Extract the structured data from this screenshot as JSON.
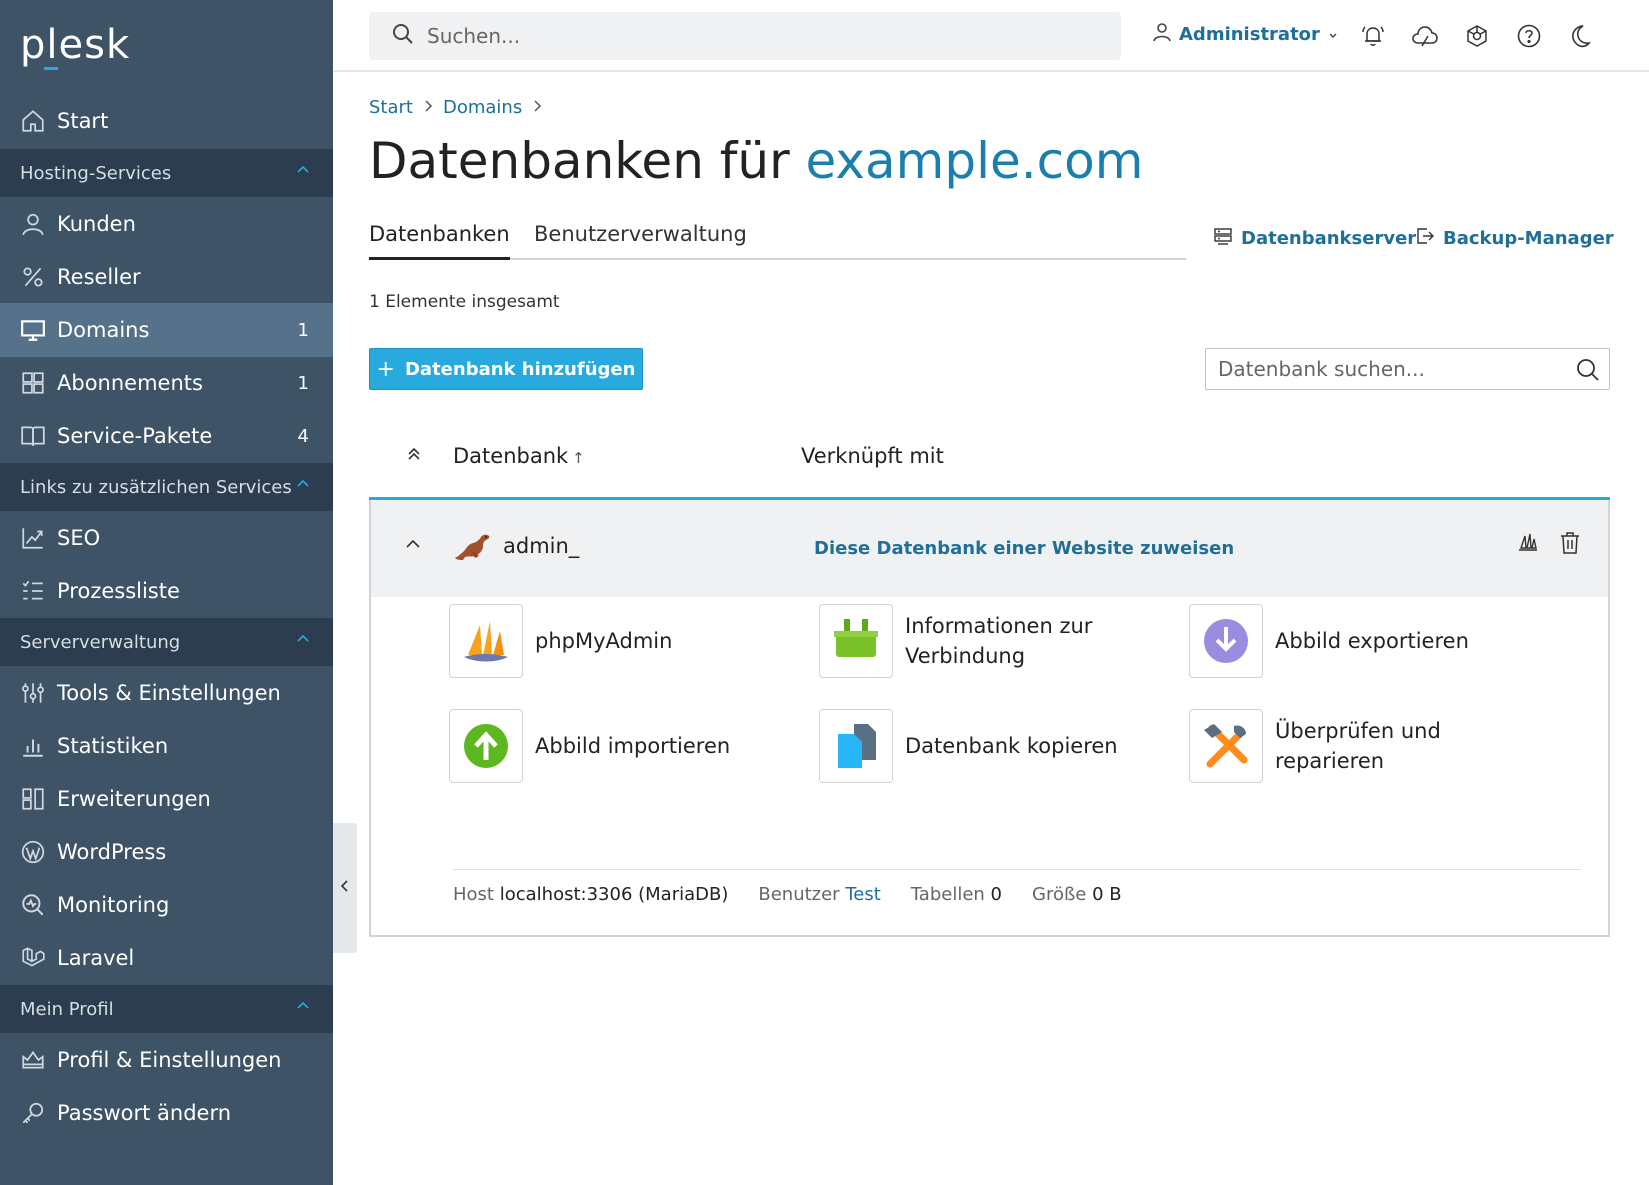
{
  "app": {
    "logo": "plesk"
  },
  "sidebar": {
    "items": [
      {
        "label": "Start",
        "icon": "home-icon"
      },
      {
        "section": "Hosting-Services"
      },
      {
        "label": "Kunden",
        "icon": "user-icon"
      },
      {
        "label": "Reseller",
        "icon": "percent-icon"
      },
      {
        "label": "Domains",
        "icon": "monitor-icon",
        "count": "1",
        "active": true
      },
      {
        "label": "Abonnements",
        "icon": "grid-icon",
        "count": "1"
      },
      {
        "label": "Service-Pakete",
        "icon": "book-icon",
        "count": "4"
      },
      {
        "section": "Links zu zusätzlichen Services"
      },
      {
        "label": "SEO",
        "icon": "chart-icon"
      },
      {
        "label": "Prozessliste",
        "icon": "list-icon"
      },
      {
        "section": "Serververwaltung"
      },
      {
        "label": "Tools & Einstellungen",
        "icon": "sliders-icon"
      },
      {
        "label": "Statistiken",
        "icon": "bar-chart-icon"
      },
      {
        "label": "Erweiterungen",
        "icon": "extensions-icon"
      },
      {
        "label": "WordPress",
        "icon": "wordpress-icon"
      },
      {
        "label": "Monitoring",
        "icon": "monitoring-icon"
      },
      {
        "label": "Laravel",
        "icon": "laravel-icon"
      },
      {
        "section": "Mein Profil"
      },
      {
        "label": "Profil & Einstellungen",
        "icon": "profile-icon"
      },
      {
        "label": "Passwort ändern",
        "icon": "key-icon"
      }
    ]
  },
  "topbar": {
    "search_placeholder": "Suchen...",
    "user": "Administrator"
  },
  "breadcrumb": [
    "Start",
    "Domains"
  ],
  "page": {
    "title_prefix": "Datenbanken für",
    "title_domain": "example.com"
  },
  "tabs": [
    "Datenbanken",
    "Benutzerverwaltung"
  ],
  "links": {
    "db_server": "Datenbankserver",
    "backup": "Backup-Manager"
  },
  "total": "1 Elemente insgesamt",
  "add_button": "Datenbank hinzufügen",
  "db_search_placeholder": "Datenbank suchen...",
  "list": {
    "col_db": "Datenbank",
    "col_linked": "Verknüpft mit",
    "row": {
      "name": "admin_",
      "assign": "Diese Datenbank einer Website zuweisen",
      "tools": [
        "phpMyAdmin",
        "Informationen zur Verbindung",
        "Abbild exportieren",
        "Abbild importieren",
        "Datenbank kopieren",
        "Überprüfen und reparieren"
      ],
      "meta": {
        "host_label": "Host",
        "host_value": "localhost:3306 (MariaDB)",
        "user_label": "Benutzer",
        "user_value": "Test",
        "tables_label": "Tabellen",
        "tables_value": "0",
        "size_label": "Größe",
        "size_value": "0 B"
      }
    }
  },
  "colors": {
    "accent": "#28aade",
    "link": "#1f6f98",
    "sidebar": "#3e5366",
    "section": "#2b3d4f",
    "active": "#56718a"
  }
}
